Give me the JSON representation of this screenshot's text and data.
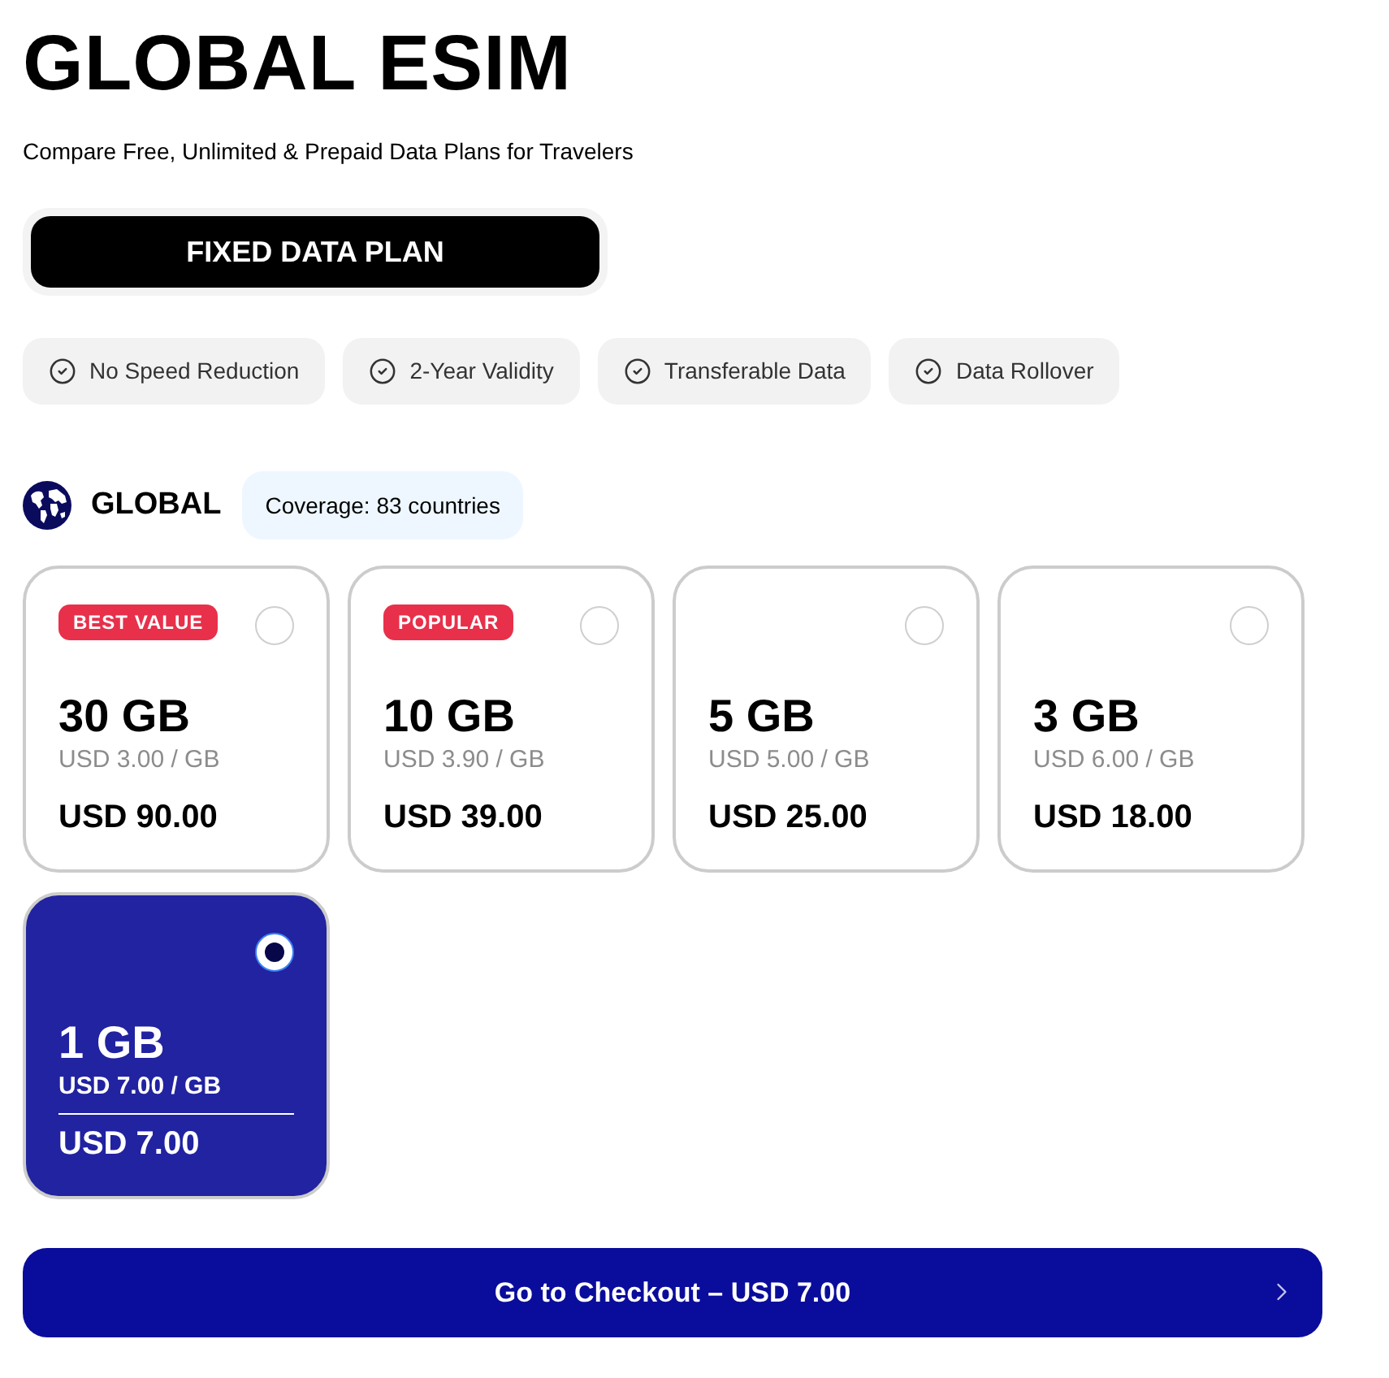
{
  "header": {
    "title": "GLOBAL ESIM",
    "subtitle": "Compare Free, Unlimited & Prepaid Data Plans for Travelers"
  },
  "plan_tabs": [
    {
      "label": "FIXED DATA PLAN",
      "selected": true
    }
  ],
  "features": [
    "No Speed Reduction",
    "2-Year Validity",
    "Transferable Data",
    "Data Rollover"
  ],
  "region": {
    "name": "GLOBAL",
    "coverage": "Coverage: 83 countries"
  },
  "plans": [
    {
      "badge": "BEST VALUE",
      "data": "30 GB",
      "per_gb": "USD 3.00 / GB",
      "price": "USD 90.00",
      "selected": false
    },
    {
      "badge": "POPULAR",
      "data": "10 GB",
      "per_gb": "USD 3.90 / GB",
      "price": "USD 39.00",
      "selected": false
    },
    {
      "data": "5 GB",
      "per_gb": "USD 5.00 / GB",
      "price": "USD 25.00",
      "selected": false
    },
    {
      "data": "3 GB",
      "per_gb": "USD 6.00 / GB",
      "price": "USD 18.00",
      "selected": false
    },
    {
      "data": "1 GB",
      "per_gb": "USD 7.00 / GB",
      "price": "USD 7.00",
      "selected": true
    }
  ],
  "checkout": {
    "label": "Go to Checkout – USD 7.00"
  }
}
